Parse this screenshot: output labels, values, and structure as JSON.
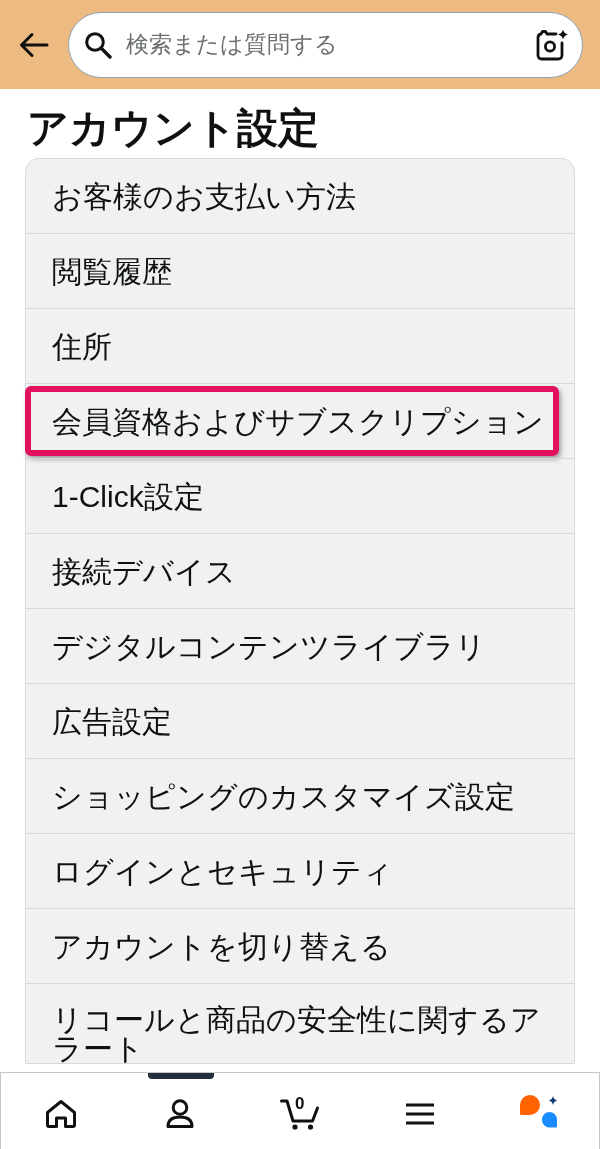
{
  "header": {
    "search": {
      "placeholder": "検索または質問する"
    }
  },
  "title": "アカウント設定",
  "settings_list": [
    {
      "label": "お客様のお支払い方法",
      "highlighted": false
    },
    {
      "label": "閲覧履歴",
      "highlighted": false
    },
    {
      "label": "住所",
      "highlighted": false
    },
    {
      "label": "会員資格およびサブスクリプション",
      "highlighted": true
    },
    {
      "label": "1-Click設定",
      "highlighted": false
    },
    {
      "label": "接続デバイス",
      "highlighted": false
    },
    {
      "label": "デジタルコンテンツライブラリ",
      "highlighted": false
    },
    {
      "label": "広告設定",
      "highlighted": false
    },
    {
      "label": "ショッピングのカスタマイズ設定",
      "highlighted": false
    },
    {
      "label": "ログインとセキュリティ",
      "highlighted": false
    },
    {
      "label": "アカウントを切り替える",
      "highlighted": false
    },
    {
      "label": "リコールと商品の安全性に関するアラート",
      "highlighted": false
    }
  ],
  "bottom_nav": [
    {
      "kind": "home",
      "selected": false
    },
    {
      "kind": "account",
      "selected": true
    },
    {
      "kind": "cart",
      "selected": false,
      "count": "0"
    },
    {
      "kind": "menu",
      "selected": false
    },
    {
      "kind": "assistant",
      "selected": false
    }
  ]
}
